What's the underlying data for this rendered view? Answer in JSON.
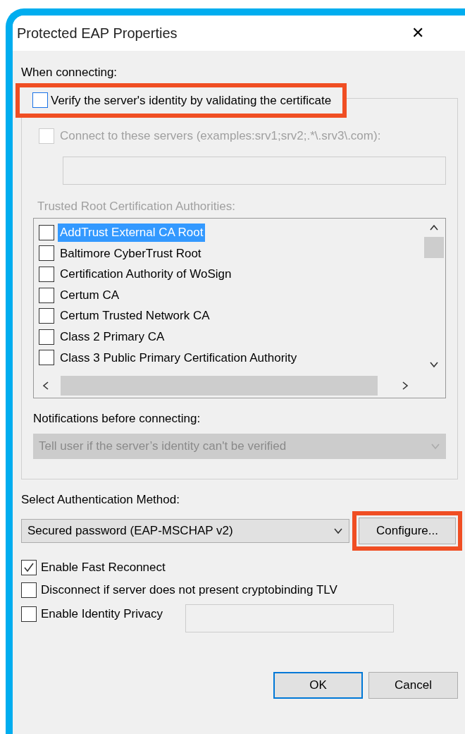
{
  "window": {
    "title": "Protected EAP Properties",
    "close": "✕"
  },
  "when_connecting_label": "When connecting:",
  "verify_checkbox": {
    "label": "Verify the server's identity by validating the certificate",
    "checked": false,
    "highlighted": true
  },
  "connect_servers_checkbox": {
    "label": "Connect to these servers (examples:srv1;srv2;.*\\.srv3\\.com):",
    "checked": false,
    "disabled": true
  },
  "servers_field": {
    "disabled": true
  },
  "trusted_root_label": "Trusted Root Certification Authorities:",
  "certificates": [
    {
      "name": "AddTrust External CA Root",
      "checked": false,
      "selected": true
    },
    {
      "name": "Baltimore CyberTrust Root",
      "checked": false,
      "selected": false
    },
    {
      "name": "Certification Authority of WoSign",
      "checked": false,
      "selected": false
    },
    {
      "name": "Certum CA",
      "checked": false,
      "selected": false
    },
    {
      "name": "Certum Trusted Network CA",
      "checked": false,
      "selected": false
    },
    {
      "name": "Class 2 Primary CA",
      "checked": false,
      "selected": false
    },
    {
      "name": "Class 3 Public Primary Certification Authority",
      "checked": false,
      "selected": false
    }
  ],
  "notifications_label": "Notifications before connecting:",
  "notifications_dropdown": {
    "value": "Tell user if the server’s identity can't be verified",
    "disabled": true
  },
  "auth_method_label": "Select Authentication Method:",
  "auth_method_dropdown": {
    "value": "Secured password (EAP-MSCHAP v2)"
  },
  "configure_button": {
    "label": "Configure...",
    "highlighted": true
  },
  "options": [
    {
      "label": "Enable Fast Reconnect",
      "checked": true
    },
    {
      "label": "Disconnect if server does not present cryptobinding TLV",
      "checked": false
    },
    {
      "label": "Enable Identity Privacy",
      "checked": false
    }
  ],
  "buttons": [
    {
      "label": "OK",
      "default": true
    },
    {
      "label": "Cancel",
      "default": false
    }
  ]
}
